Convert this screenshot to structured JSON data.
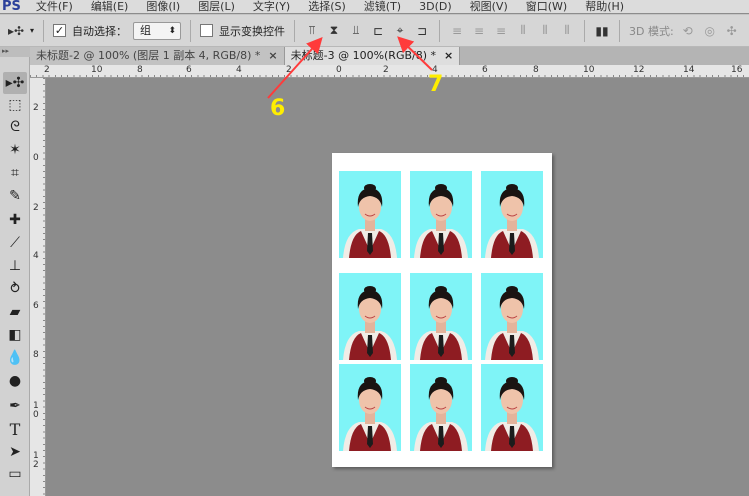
{
  "app": {
    "logo": "PS"
  },
  "menu": [
    "文件(F)",
    "编辑(E)",
    "图像(I)",
    "图层(L)",
    "文字(Y)",
    "选择(S)",
    "滤镜(T)",
    "3D(D)",
    "视图(V)",
    "窗口(W)",
    "帮助(H)"
  ],
  "options": {
    "auto_select_label": "自动选择：",
    "auto_select_checked": true,
    "auto_select_value": "组",
    "transform_label": "显示变换控件",
    "transform_checked": false,
    "mode_label": "3D 模式:"
  },
  "tabs": [
    {
      "label": "未标题-2 @ 100% (图层 1 副本 4, RGB/8) *",
      "active": false
    },
    {
      "label": "未标题-3 @ 100%(RGB/8) *",
      "active": true
    }
  ],
  "hruler": [
    "2",
    "10",
    "8",
    "6",
    "4",
    "2",
    "0",
    "2",
    "4",
    "6",
    "8",
    "10",
    "12",
    "14",
    "16"
  ],
  "vruler": [
    "2",
    "0",
    "2",
    "4",
    "6",
    "8",
    "1\n0",
    "1\n2"
  ],
  "annotations": {
    "six": "6",
    "seven": "7"
  },
  "colors": {
    "photo_bg": "#7ff4f7",
    "arrow": "#ff3b3b",
    "annotation": "#ffee00"
  }
}
